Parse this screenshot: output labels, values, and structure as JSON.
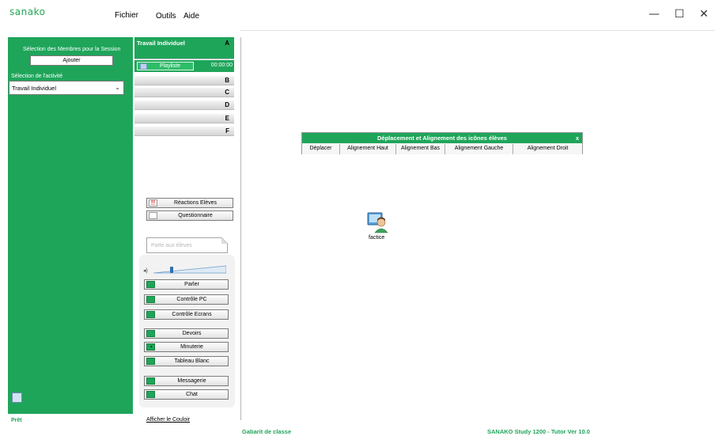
{
  "app": {
    "logo": "sanako",
    "menu": [
      "Fichier",
      "Outils",
      "Aide"
    ],
    "window_controls": {
      "minimize": "—",
      "maximize": "☐",
      "close": "✕"
    }
  },
  "left_panel": {
    "members_label": "Sélection des Membres pour la Session",
    "add_button": "Ajouter",
    "activity_label": "Sélection de l'activité",
    "activity_value": "Travail Individuel"
  },
  "activity_column": {
    "a_title": "Travail Individuel",
    "rows": [
      "A",
      "B",
      "C",
      "D",
      "E",
      "F"
    ],
    "playlist_label": "Playliste",
    "playlist_time": "00:00:00"
  },
  "buttons": {
    "reactions": "Réactions Elèves",
    "questionnaire": "Questionnaire",
    "parler_eleves_placeholder": "Parle aux élèves",
    "parler": "Parler",
    "controle_pc": "Contrôle PC",
    "controle_ecrans": "Contrôle Ecrans",
    "devoirs": "Devoirs",
    "minuterie": "Minuterie",
    "tableau_blanc": "Tableau Blanc",
    "messagerie": "Messagerie",
    "chat": "Chat"
  },
  "dialog": {
    "title": "Déplacement et Alignement des icônes élèves",
    "close": "x",
    "tabs": [
      "Déplacer",
      "Alignement Haut",
      "Alignement Bas",
      "Alignement Gauche",
      "Alignement Droit"
    ]
  },
  "student": {
    "label": "factice"
  },
  "status": {
    "left": "Prêt",
    "afficher": "Afficher le Couloir",
    "gabarit": "Gabarit de classe",
    "version": "SANAKO Study 1200 - Tutor  Ver 10.0"
  },
  "colors": {
    "accent": "#1fa55a"
  },
  "icons": {
    "playlist": "music-note-icon",
    "reactions": "exclamation-icon",
    "questionnaire": "quiz-icon",
    "parler": "talk-icon",
    "controle_pc": "pc-control-icon",
    "controle_ecrans": "screens-icon",
    "devoirs": "homework-icon",
    "minuterie": "clock-icon",
    "tableau_blanc": "whiteboard-icon",
    "messagerie": "mail-icon",
    "chat": "chat-icon"
  }
}
